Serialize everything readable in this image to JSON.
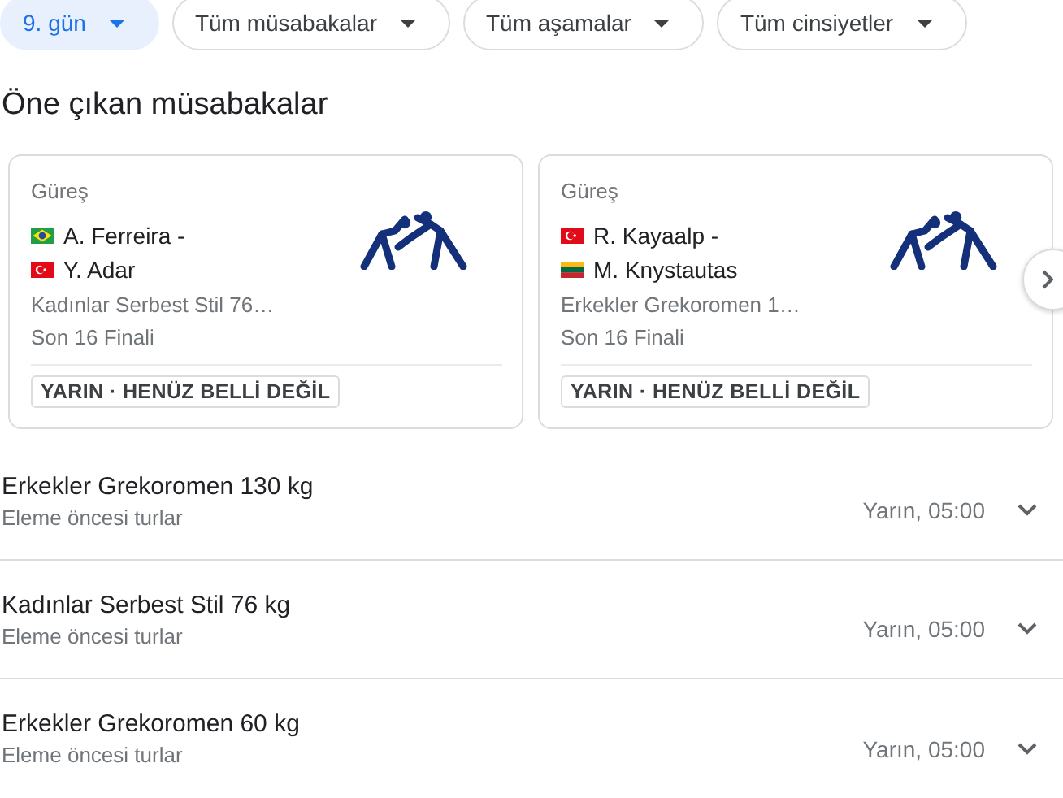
{
  "filters": [
    {
      "label": "9. gün",
      "selected": true
    },
    {
      "label": "Tüm müsabakalar",
      "selected": false
    },
    {
      "label": "Tüm aşamalar",
      "selected": false
    },
    {
      "label": "Tüm cinsiyetler",
      "selected": false
    }
  ],
  "heading": "Öne çıkan müsabakalar",
  "featured": [
    {
      "sport": "Güreş",
      "competitors": [
        {
          "name": "A. Ferreira -",
          "kind": "br"
        },
        {
          "name": "Y. Adar",
          "kind": "tr"
        }
      ],
      "event": "Kadınlar Serbest Stil 76…",
      "stage": "Son 16 Finali",
      "status": "YARIN · HENÜZ BELLİ DEĞİL"
    },
    {
      "sport": "Güreş",
      "competitors": [
        {
          "name": "R. Kayaalp -",
          "kind": "tr"
        },
        {
          "name": "M. Knystautas",
          "kind": "lt"
        }
      ],
      "event": "Erkekler Grekoromen 1…",
      "stage": "Son 16 Finali",
      "status": "YARIN · HENÜZ BELLİ DEĞİL"
    }
  ],
  "events": [
    {
      "title": "Erkekler Grekoromen 130 kg",
      "subtitle": "Eleme öncesi turlar",
      "time": "Yarın, 05:00",
      "expanded": false
    },
    {
      "title": "Kadınlar Serbest Stil 76 kg",
      "subtitle": "Eleme öncesi turlar",
      "time": "Yarın, 05:00",
      "expanded": false
    },
    {
      "title": "Erkekler Grekoromen 60 kg",
      "subtitle": "Eleme öncesi turlar",
      "time": "Yarın, 05:00",
      "expanded": false
    }
  ]
}
